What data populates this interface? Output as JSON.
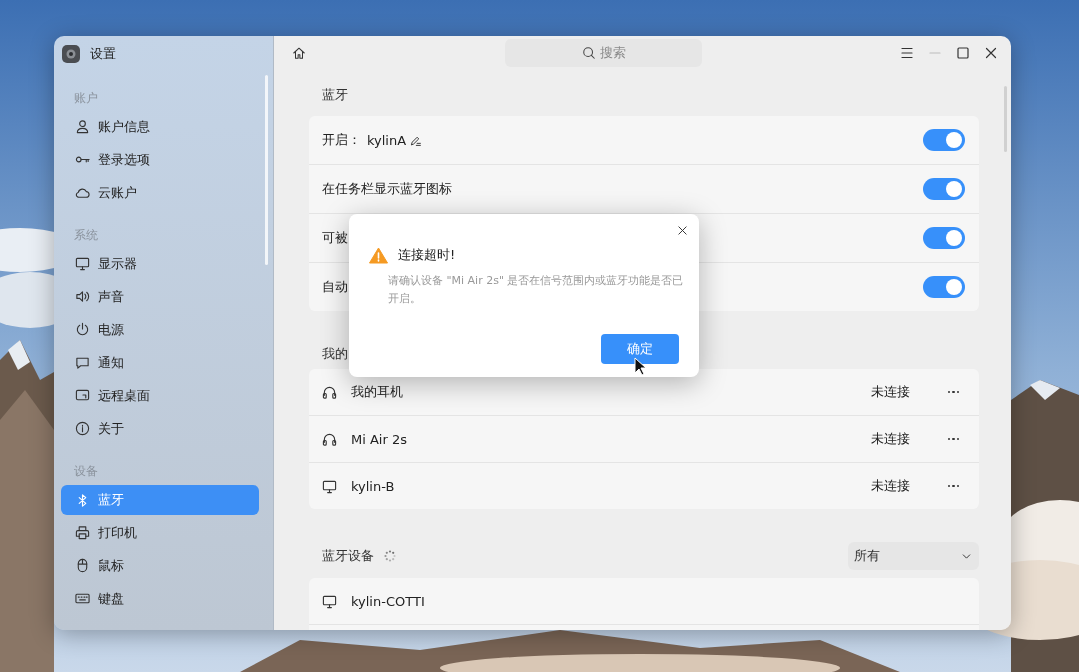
{
  "window": {
    "title": "设置"
  },
  "search": {
    "placeholder": "搜索"
  },
  "sidebar": {
    "groups": [
      {
        "title": "账户",
        "items": [
          {
            "label": "账户信息",
            "kind": "user",
            "selected": false
          },
          {
            "label": "登录选项",
            "kind": "key",
            "selected": false
          },
          {
            "label": "云账户",
            "kind": "cloud",
            "selected": false
          }
        ]
      },
      {
        "title": "系统",
        "items": [
          {
            "label": "显示器",
            "kind": "monitor",
            "selected": false
          },
          {
            "label": "声音",
            "kind": "speaker",
            "selected": false
          },
          {
            "label": "电源",
            "kind": "power",
            "selected": false
          },
          {
            "label": "通知",
            "kind": "chat",
            "selected": false
          },
          {
            "label": "远程桌面",
            "kind": "remote",
            "selected": false
          },
          {
            "label": "关于",
            "kind": "info",
            "selected": false
          }
        ]
      },
      {
        "title": "设备",
        "items": [
          {
            "label": "蓝牙",
            "kind": "bluetooth",
            "selected": true
          },
          {
            "label": "打印机",
            "kind": "printer",
            "selected": false
          },
          {
            "label": "鼠标",
            "kind": "mouse",
            "selected": false
          },
          {
            "label": "键盘",
            "kind": "keyboard",
            "selected": false
          }
        ]
      }
    ]
  },
  "bluetooth": {
    "title": "蓝牙",
    "settings": [
      {
        "label": "开启：",
        "value": "kylinA",
        "on": true
      },
      {
        "label": "在任务栏显示蓝牙图标",
        "on": true
      },
      {
        "label": "可被",
        "on": true
      },
      {
        "label": "自动",
        "on": true
      }
    ]
  },
  "my_devices": {
    "title": "我的",
    "devices": [
      {
        "name": "我的耳机",
        "kind": "headphones",
        "status": "未连接"
      },
      {
        "name": "Mi Air 2s",
        "kind": "headphones",
        "status": "未连接"
      },
      {
        "name": "kylin-B",
        "kind": "monitor",
        "status": "未连接"
      }
    ]
  },
  "nearby_devices": {
    "title": "蓝牙设备",
    "filter": "所有",
    "devices": [
      {
        "name": "kylin-COTTI",
        "kind": "monitor"
      }
    ]
  },
  "dialog": {
    "title": "连接超时!",
    "message": "请确认设备 \"Mi Air 2s\" 是否在信号范围内或蓝牙功能是否已开启。",
    "button": "确定"
  }
}
